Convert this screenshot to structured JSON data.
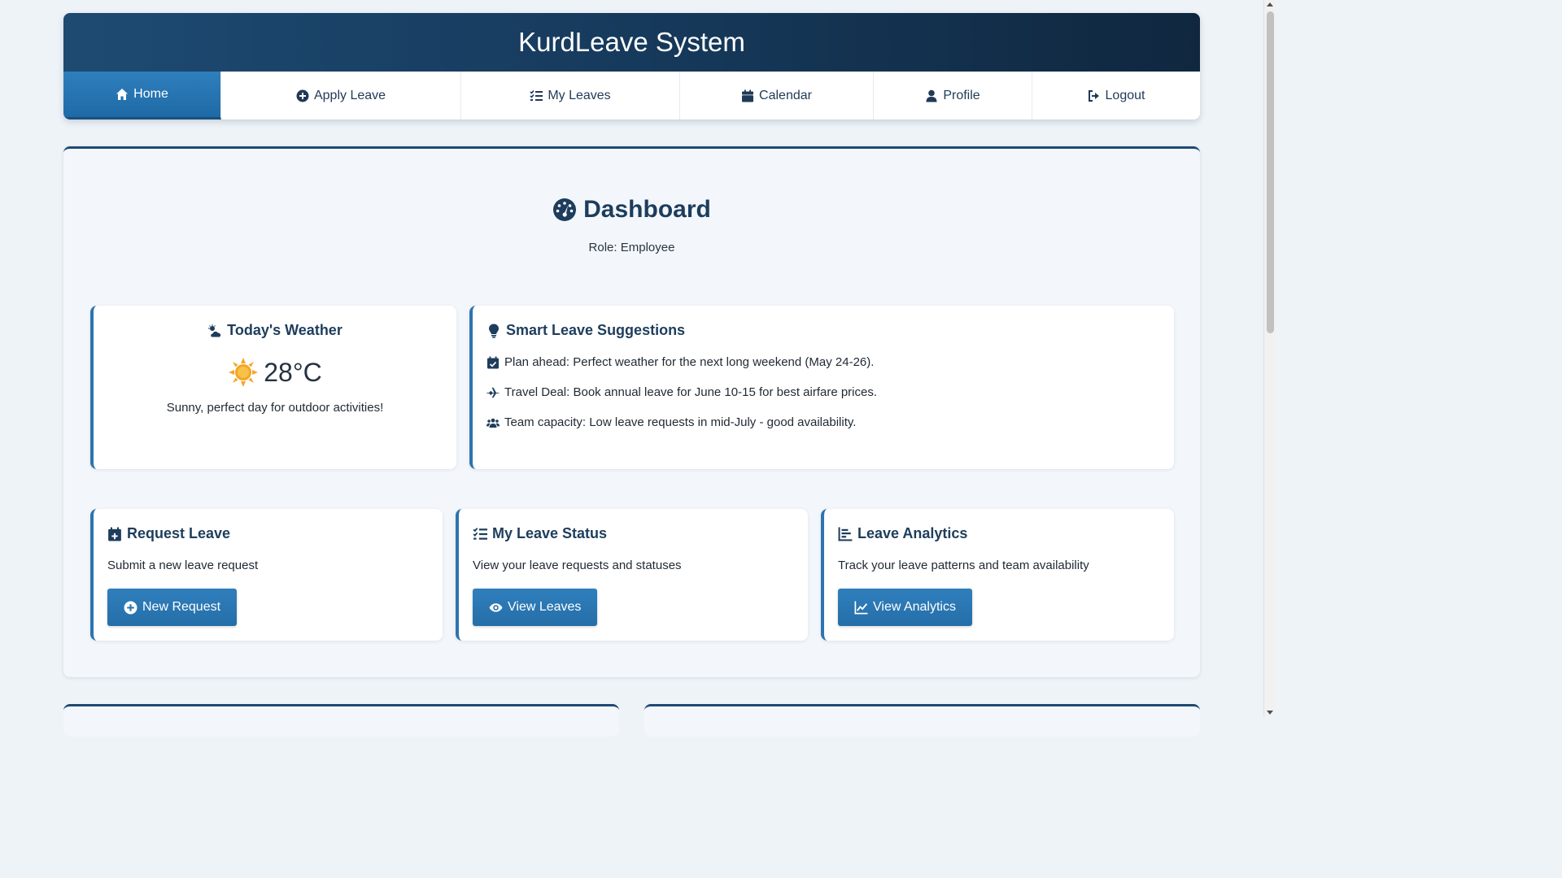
{
  "app": {
    "title": "KurdLeave System"
  },
  "nav": {
    "home": "Home",
    "apply": "Apply Leave",
    "my_leaves": "My Leaves",
    "calendar": "Calendar",
    "profile": "Profile",
    "logout": "Logout"
  },
  "dashboard": {
    "title": "Dashboard",
    "role": "Role: Employee"
  },
  "weather": {
    "title": "Today's Weather",
    "temperature": "28°C",
    "description": "Sunny, perfect day for outdoor activities!",
    "icon": "sun-icon"
  },
  "suggestions": {
    "title": "Smart Leave Suggestions",
    "items": [
      {
        "icon": "calendar-check-icon",
        "text": "Plan ahead: Perfect weather for the next long weekend (May 24-26)."
      },
      {
        "icon": "plane-icon",
        "text": "Travel Deal: Book annual leave for June 10-15 for best airfare prices."
      },
      {
        "icon": "users-icon",
        "text": "Team capacity: Low leave requests in mid-July - good availability."
      }
    ]
  },
  "cards": {
    "request": {
      "title": "Request Leave",
      "desc": "Submit a new leave request",
      "button": "New Request"
    },
    "status": {
      "title": "My Leave Status",
      "desc": "View your leave requests and statuses",
      "button": "View Leaves"
    },
    "analytics": {
      "title": "Leave Analytics",
      "desc": "Track your leave patterns and team availability",
      "button": "View Analytics"
    }
  },
  "colors": {
    "primary": "#1e4a72",
    "accent": "#2d74b0",
    "sun": "#f5a623"
  }
}
